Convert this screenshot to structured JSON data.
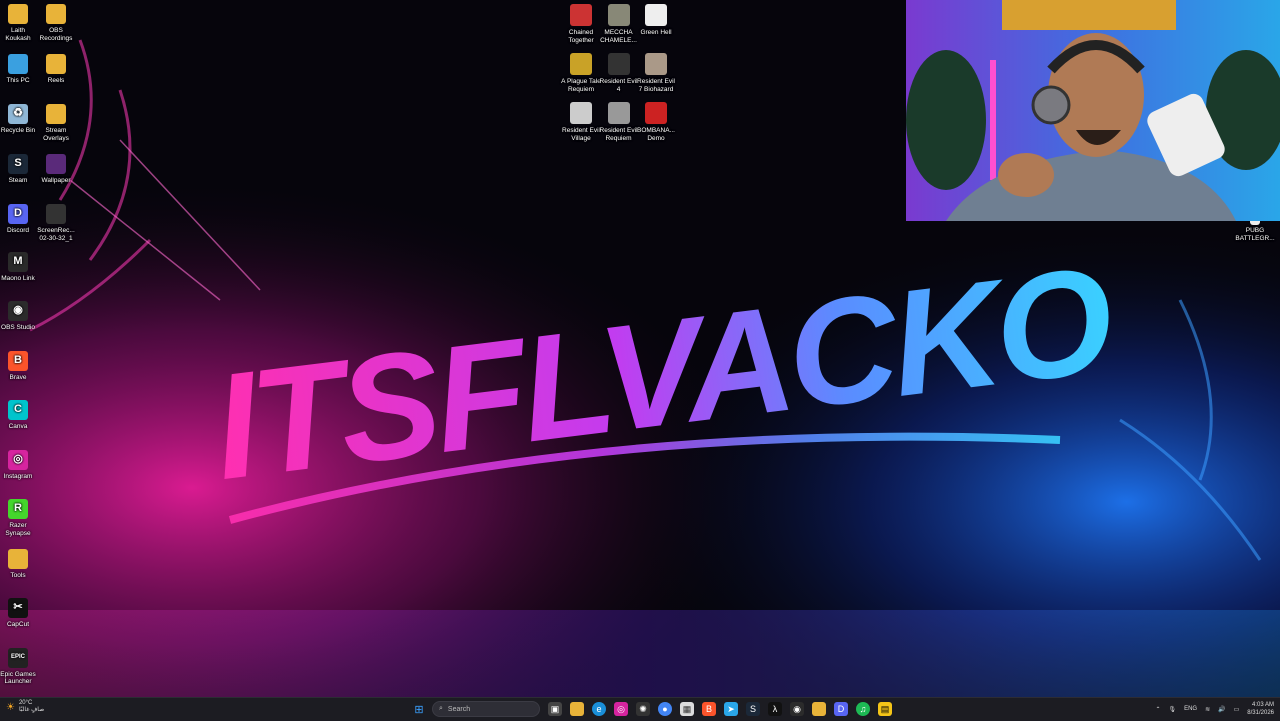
{
  "desktop": {
    "left_icons": [
      {
        "name": "user-folder",
        "label": "Laith\nKoukash",
        "glyph": "",
        "color": "#e8b339"
      },
      {
        "name": "obs-recordings",
        "label": "OBS\nRecordings",
        "glyph": "",
        "color": "#e8b339"
      },
      {
        "name": "this-pc",
        "label": "This PC",
        "glyph": "",
        "color": "#3aa0e0"
      },
      {
        "name": "reels",
        "label": "Reels",
        "glyph": "",
        "color": "#e8b339"
      },
      {
        "name": "recycle-bin",
        "label": "Recycle Bin",
        "glyph": "♻",
        "color": "#8fb7d6"
      },
      {
        "name": "stream-overlays",
        "label": "Stream\nOverlays",
        "glyph": "",
        "color": "#e8b339"
      },
      {
        "name": "steam",
        "label": "Steam",
        "glyph": "S",
        "color": "#1b2838"
      },
      {
        "name": "wallpaper",
        "label": "Wallpaper",
        "glyph": "",
        "color": "#5a2a7a"
      },
      {
        "name": "discord",
        "label": "Discord",
        "glyph": "D",
        "color": "#5865f2"
      },
      {
        "name": "screen-recording",
        "label": "ScreenRec...\n02-30-32_1",
        "glyph": "",
        "color": "#333"
      },
      {
        "name": "maono-link",
        "label": "Maono Link",
        "glyph": "M",
        "color": "#2a2a2a"
      },
      {
        "name": "obs-studio",
        "label": "OBS Studio",
        "glyph": "◉",
        "color": "#2b2b2b"
      },
      {
        "name": "brave",
        "label": "Brave",
        "glyph": "B",
        "color": "#fb542b"
      },
      {
        "name": "canva",
        "label": "Canva",
        "glyph": "C",
        "color": "#00c4cc"
      },
      {
        "name": "instagram",
        "label": "Instagram",
        "glyph": "◎",
        "color": "#d6249f"
      },
      {
        "name": "razer-synapse",
        "label": "Razer\nSynapse",
        "glyph": "R",
        "color": "#44d62c"
      },
      {
        "name": "tools",
        "label": "Tools",
        "glyph": "",
        "color": "#e8b339"
      },
      {
        "name": "capcut",
        "label": "CapCut",
        "glyph": "✂",
        "color": "#111"
      },
      {
        "name": "epic-games",
        "label": "Epic Games\nLauncher",
        "glyph": "EPIC",
        "color": "#222"
      }
    ],
    "game_icons": [
      {
        "name": "chained-together",
        "label": "Chained\nTogether",
        "color": "#c33"
      },
      {
        "name": "meccha-chameleon",
        "label": "MECCHA\nCHAMELE...",
        "color": "#887"
      },
      {
        "name": "green-hell",
        "label": "Green Hell",
        "color": "#eee"
      },
      {
        "name": "plague-tale",
        "label": "A Plague Tale\nRequiem",
        "color": "#c9a227"
      },
      {
        "name": "re4",
        "label": "Resident Evil\n4",
        "color": "#333"
      },
      {
        "name": "re7",
        "label": "Resident Evil\n7 Biohazard",
        "color": "#a98"
      },
      {
        "name": "re-village",
        "label": "Resident Evil\nVillage",
        "color": "#ccc"
      },
      {
        "name": "re-requiem",
        "label": "Resident Evil\nRequiem",
        "color": "#999"
      },
      {
        "name": "bombana-demo",
        "label": "BOMBANA...\nDemo",
        "color": "#c22"
      }
    ],
    "pubg_icon": {
      "label": "PUBG\nBATTLEGR..."
    },
    "wallpaper_title": "ITSFLVACKO"
  },
  "taskbar": {
    "weather_temp": "20°C",
    "weather_desc": "صافٍ غالبًا",
    "search_placeholder": "Search",
    "language": "ENG",
    "time": "4:03 AM",
    "date": "8/31/2026"
  }
}
